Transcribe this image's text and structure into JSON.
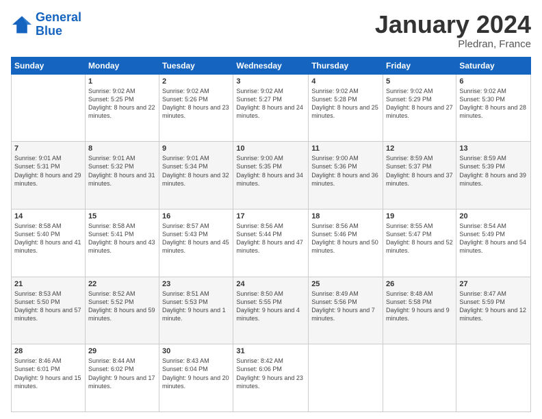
{
  "logo": {
    "line1": "General",
    "line2": "Blue"
  },
  "title": "January 2024",
  "location": "Pledran, France",
  "days_header": [
    "Sunday",
    "Monday",
    "Tuesday",
    "Wednesday",
    "Thursday",
    "Friday",
    "Saturday"
  ],
  "weeks": [
    [
      {
        "day": "",
        "sunrise": "",
        "sunset": "",
        "daylight": ""
      },
      {
        "day": "1",
        "sunrise": "9:02 AM",
        "sunset": "5:25 PM",
        "daylight": "8 hours and 22 minutes."
      },
      {
        "day": "2",
        "sunrise": "9:02 AM",
        "sunset": "5:26 PM",
        "daylight": "8 hours and 23 minutes."
      },
      {
        "day": "3",
        "sunrise": "9:02 AM",
        "sunset": "5:27 PM",
        "daylight": "8 hours and 24 minutes."
      },
      {
        "day": "4",
        "sunrise": "9:02 AM",
        "sunset": "5:28 PM",
        "daylight": "8 hours and 25 minutes."
      },
      {
        "day": "5",
        "sunrise": "9:02 AM",
        "sunset": "5:29 PM",
        "daylight": "8 hours and 27 minutes."
      },
      {
        "day": "6",
        "sunrise": "9:02 AM",
        "sunset": "5:30 PM",
        "daylight": "8 hours and 28 minutes."
      }
    ],
    [
      {
        "day": "7",
        "sunrise": "9:01 AM",
        "sunset": "5:31 PM",
        "daylight": "8 hours and 29 minutes."
      },
      {
        "day": "8",
        "sunrise": "9:01 AM",
        "sunset": "5:32 PM",
        "daylight": "8 hours and 31 minutes."
      },
      {
        "day": "9",
        "sunrise": "9:01 AM",
        "sunset": "5:34 PM",
        "daylight": "8 hours and 32 minutes."
      },
      {
        "day": "10",
        "sunrise": "9:00 AM",
        "sunset": "5:35 PM",
        "daylight": "8 hours and 34 minutes."
      },
      {
        "day": "11",
        "sunrise": "9:00 AM",
        "sunset": "5:36 PM",
        "daylight": "8 hours and 36 minutes."
      },
      {
        "day": "12",
        "sunrise": "8:59 AM",
        "sunset": "5:37 PM",
        "daylight": "8 hours and 37 minutes."
      },
      {
        "day": "13",
        "sunrise": "8:59 AM",
        "sunset": "5:39 PM",
        "daylight": "8 hours and 39 minutes."
      }
    ],
    [
      {
        "day": "14",
        "sunrise": "8:58 AM",
        "sunset": "5:40 PM",
        "daylight": "8 hours and 41 minutes."
      },
      {
        "day": "15",
        "sunrise": "8:58 AM",
        "sunset": "5:41 PM",
        "daylight": "8 hours and 43 minutes."
      },
      {
        "day": "16",
        "sunrise": "8:57 AM",
        "sunset": "5:43 PM",
        "daylight": "8 hours and 45 minutes."
      },
      {
        "day": "17",
        "sunrise": "8:56 AM",
        "sunset": "5:44 PM",
        "daylight": "8 hours and 47 minutes."
      },
      {
        "day": "18",
        "sunrise": "8:56 AM",
        "sunset": "5:46 PM",
        "daylight": "8 hours and 50 minutes."
      },
      {
        "day": "19",
        "sunrise": "8:55 AM",
        "sunset": "5:47 PM",
        "daylight": "8 hours and 52 minutes."
      },
      {
        "day": "20",
        "sunrise": "8:54 AM",
        "sunset": "5:49 PM",
        "daylight": "8 hours and 54 minutes."
      }
    ],
    [
      {
        "day": "21",
        "sunrise": "8:53 AM",
        "sunset": "5:50 PM",
        "daylight": "8 hours and 57 minutes."
      },
      {
        "day": "22",
        "sunrise": "8:52 AM",
        "sunset": "5:52 PM",
        "daylight": "8 hours and 59 minutes."
      },
      {
        "day": "23",
        "sunrise": "8:51 AM",
        "sunset": "5:53 PM",
        "daylight": "9 hours and 1 minute."
      },
      {
        "day": "24",
        "sunrise": "8:50 AM",
        "sunset": "5:55 PM",
        "daylight": "9 hours and 4 minutes."
      },
      {
        "day": "25",
        "sunrise": "8:49 AM",
        "sunset": "5:56 PM",
        "daylight": "9 hours and 7 minutes."
      },
      {
        "day": "26",
        "sunrise": "8:48 AM",
        "sunset": "5:58 PM",
        "daylight": "9 hours and 9 minutes."
      },
      {
        "day": "27",
        "sunrise": "8:47 AM",
        "sunset": "5:59 PM",
        "daylight": "9 hours and 12 minutes."
      }
    ],
    [
      {
        "day": "28",
        "sunrise": "8:46 AM",
        "sunset": "6:01 PM",
        "daylight": "9 hours and 15 minutes."
      },
      {
        "day": "29",
        "sunrise": "8:44 AM",
        "sunset": "6:02 PM",
        "daylight": "9 hours and 17 minutes."
      },
      {
        "day": "30",
        "sunrise": "8:43 AM",
        "sunset": "6:04 PM",
        "daylight": "9 hours and 20 minutes."
      },
      {
        "day": "31",
        "sunrise": "8:42 AM",
        "sunset": "6:06 PM",
        "daylight": "9 hours and 23 minutes."
      },
      {
        "day": "",
        "sunrise": "",
        "sunset": "",
        "daylight": ""
      },
      {
        "day": "",
        "sunrise": "",
        "sunset": "",
        "daylight": ""
      },
      {
        "day": "",
        "sunrise": "",
        "sunset": "",
        "daylight": ""
      }
    ]
  ]
}
